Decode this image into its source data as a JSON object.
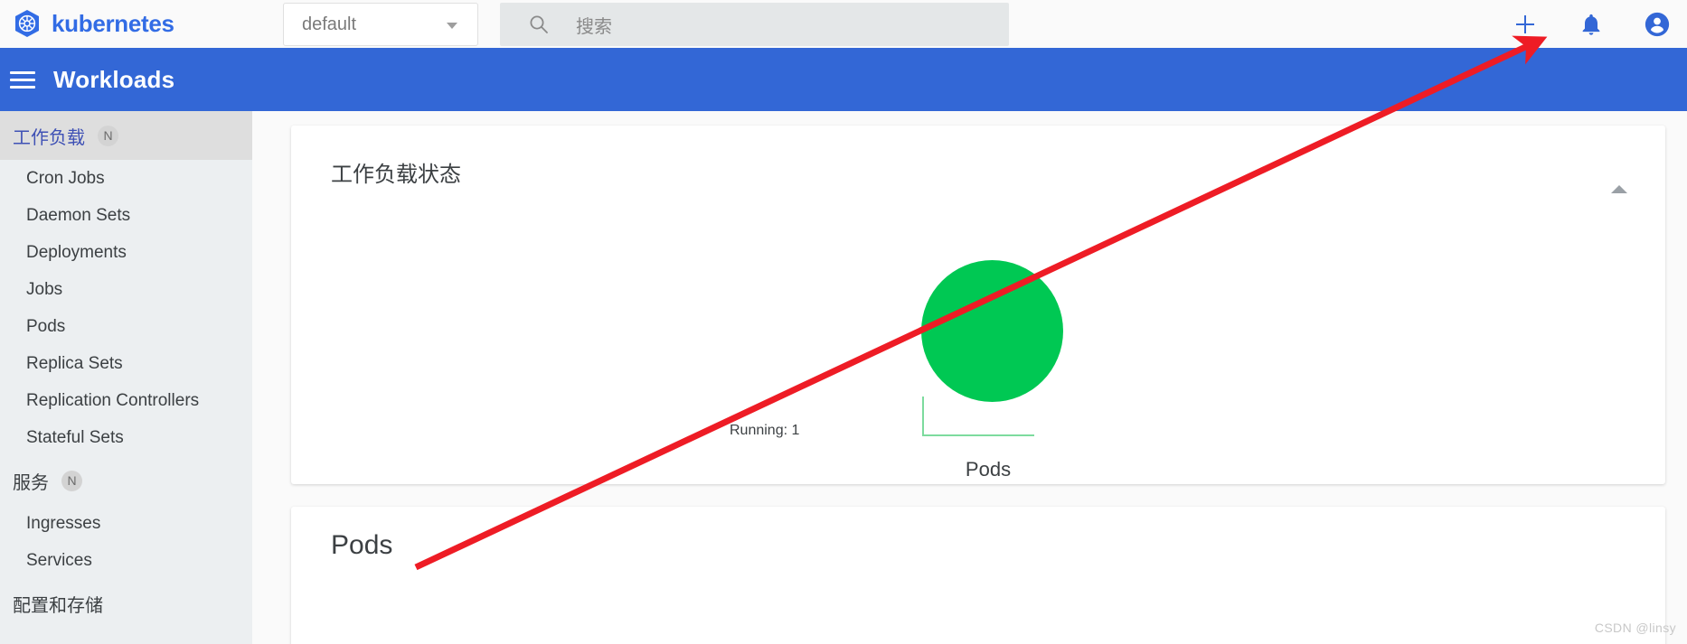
{
  "brand": {
    "name": "kubernetes",
    "logo_icon": "kubernetes-helm-icon",
    "color": "#326ce5"
  },
  "topbar": {
    "namespace_select": {
      "value": "default",
      "caret_icon": "chevron-down-icon"
    },
    "search": {
      "placeholder": "搜索",
      "value": "",
      "icon": "search-icon"
    },
    "actions": [
      {
        "name": "create-button",
        "icon": "plus-icon",
        "color": "#3367d6"
      },
      {
        "name": "notifications-button",
        "icon": "bell-icon",
        "color": "#3367d6"
      },
      {
        "name": "account-button",
        "icon": "account-circle-icon",
        "color": "#3367d6"
      }
    ]
  },
  "header": {
    "menu_icon": "hamburger-menu-icon",
    "title": "Workloads",
    "background": "#3367d6"
  },
  "sidebar": {
    "groups": [
      {
        "label": "工作负载",
        "badge": "N",
        "active": true,
        "items": [
          "Cron Jobs",
          "Daemon Sets",
          "Deployments",
          "Jobs",
          "Pods",
          "Replica Sets",
          "Replication Controllers",
          "Stateful Sets"
        ]
      },
      {
        "label": "服务",
        "badge": "N",
        "active": false,
        "items": [
          "Ingresses",
          "Services"
        ]
      },
      {
        "label": "配置和存储",
        "badge": "",
        "active": false,
        "items": []
      }
    ]
  },
  "main": {
    "status_card": {
      "title": "工作负载状态",
      "collapse_icon": "chevron-up-icon"
    },
    "pods_card": {
      "title": "Pods"
    }
  },
  "chart_data": {
    "type": "pie",
    "title": "Pods",
    "categories": [
      "Running"
    ],
    "values": [
      1
    ],
    "labels": [
      "Running: 1"
    ],
    "colors": [
      "#00c853"
    ],
    "legend": "none",
    "annotations": [
      "Running: 1"
    ]
  },
  "annotation": {
    "arrow_color": "#ee1c25",
    "arrow_from": "search area bottom-left",
    "arrow_to": "create-button"
  },
  "watermark": {
    "text": "CSDN @linsy"
  }
}
